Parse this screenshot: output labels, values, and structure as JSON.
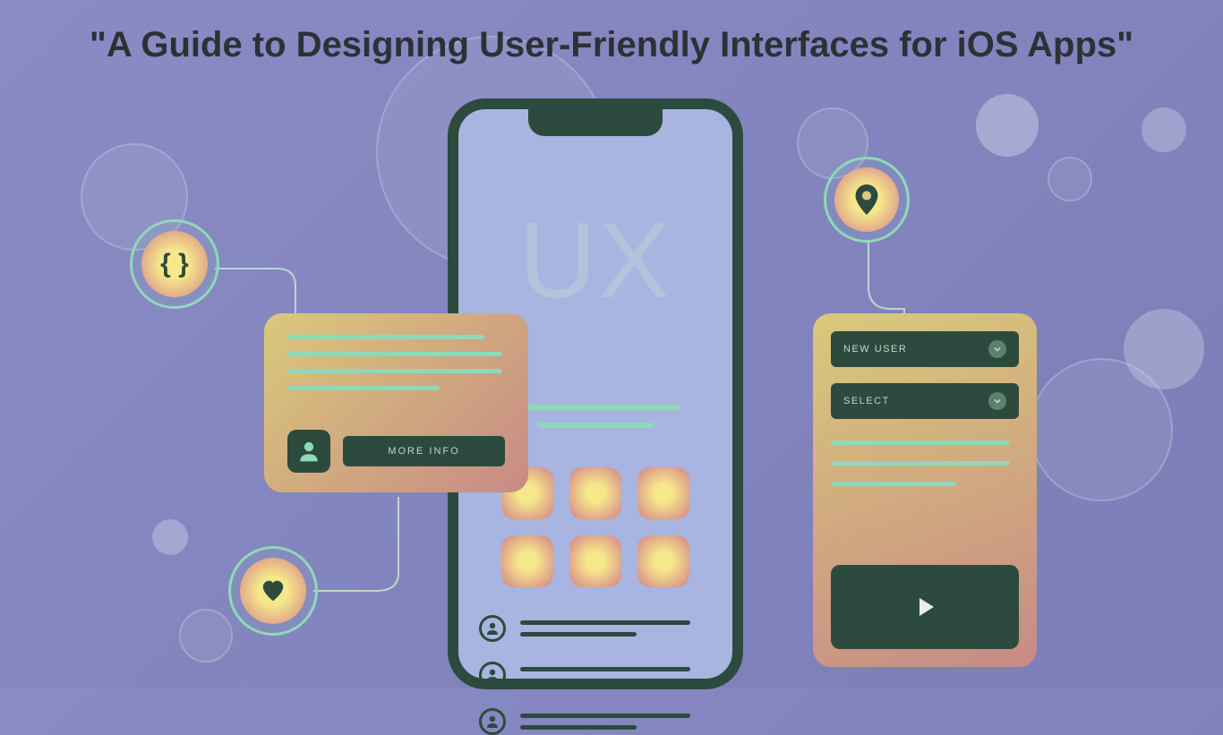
{
  "title": "\"A Guide to Designing User-Friendly Interfaces for iOS Apps\"",
  "phone": {
    "hero_text": "UX"
  },
  "info_card": {
    "button_label": "MORE INFO"
  },
  "panel_card": {
    "dropdown1": "NEW USER",
    "dropdown2": "SELECT"
  },
  "badges": {
    "code_glyph": "{ }"
  }
}
